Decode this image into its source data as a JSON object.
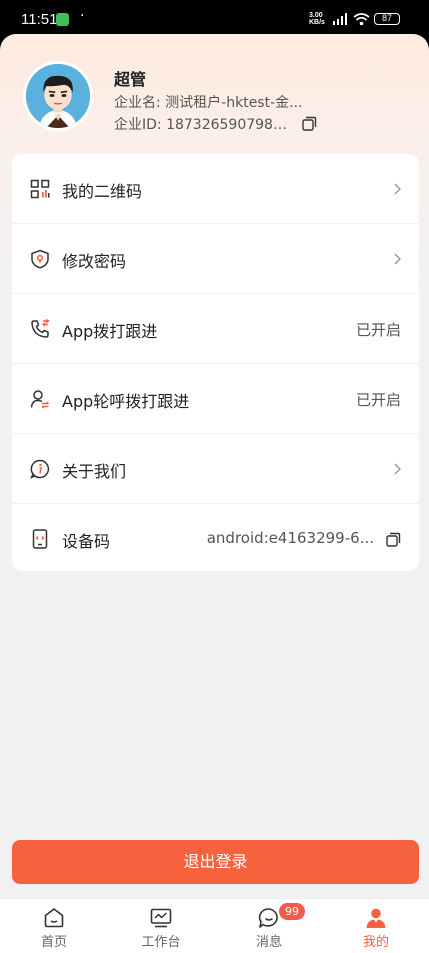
{
  "status_bar": {
    "time": "11:51",
    "dot": "·",
    "net_speed_top": "3.00",
    "net_speed_bottom": "KB/s",
    "battery": "87"
  },
  "profile": {
    "name": "超管",
    "company": "企业名: 测试租户-hktest-金...",
    "enterprise_id": "企业ID: 1873265907981...",
    "avatar_icon": "user-avatar-icon"
  },
  "menu": {
    "items": [
      {
        "label": "我的二维码",
        "icon": "qrcode-icon"
      },
      {
        "label": "修改密码",
        "icon": "shield-lock-icon"
      },
      {
        "label": "App拨打跟进",
        "icon": "phone-call-icon",
        "value": "已开启"
      },
      {
        "label": "App轮呼拨打跟进",
        "icon": "user-switch-icon",
        "value": "已开启"
      },
      {
        "label": "关于我们",
        "icon": "info-icon"
      },
      {
        "label": "设备码",
        "icon": "device-code-icon",
        "value": "android:e4163299-6..."
      }
    ]
  },
  "logout_label": "退出登录",
  "tabs": [
    {
      "label": "首页",
      "icon": "home-icon"
    },
    {
      "label": "工作台",
      "icon": "workbench-icon"
    },
    {
      "label": "消息",
      "icon": "message-icon",
      "badge": "99"
    },
    {
      "label": "我的",
      "icon": "profile-icon",
      "active": true
    }
  ],
  "colors": {
    "accent": "#f5623d",
    "badge": "#f25b4a",
    "text": "#222222",
    "muted": "#555555"
  }
}
